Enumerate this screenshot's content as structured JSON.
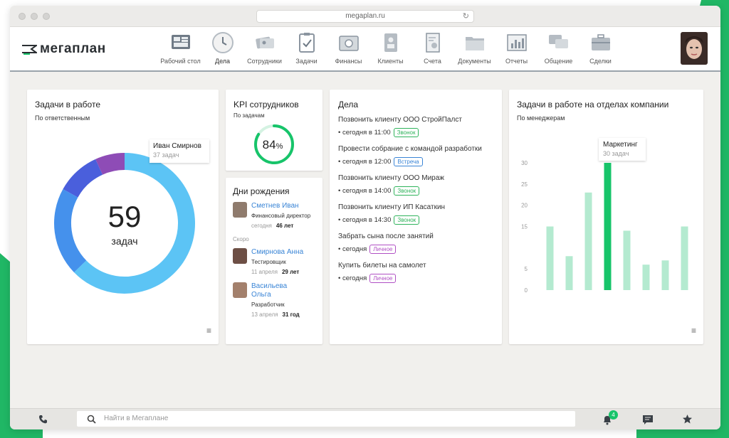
{
  "browser": {
    "url": "megaplan.ru"
  },
  "logo": {
    "text": "мегаплан"
  },
  "nav": [
    {
      "label": "Рабочий стол",
      "icon": "desktop-icon"
    },
    {
      "label": "Дела",
      "icon": "clock-icon"
    },
    {
      "label": "Сотрудники",
      "icon": "employees-icon"
    },
    {
      "label": "Задачи",
      "icon": "tasks-icon"
    },
    {
      "label": "Финансы",
      "icon": "safe-icon"
    },
    {
      "label": "Клиенты",
      "icon": "clients-icon"
    },
    {
      "label": "Счета",
      "icon": "invoice-icon"
    },
    {
      "label": "Документы",
      "icon": "folder-icon"
    },
    {
      "label": "Отчеты",
      "icon": "chart-icon"
    },
    {
      "label": "Общение",
      "icon": "chat-icon"
    },
    {
      "label": "Сделки",
      "icon": "briefcase-icon"
    }
  ],
  "tasks_card": {
    "title": "Задачи в работе",
    "subtitle": "По ответственным",
    "total": "59",
    "total_label": "задач",
    "tooltip_name": "Иван Смирнов",
    "tooltip_value": "37 задач",
    "segments": [
      {
        "value": 37,
        "color": "#5cc4f5"
      },
      {
        "value": 12,
        "color": "#4591ec"
      },
      {
        "value": 6,
        "color": "#4a5fdc"
      },
      {
        "value": 4,
        "color": "#8e4cb6"
      }
    ]
  },
  "kpi_card": {
    "title": "KPI сотрудников",
    "subtitle": "По задачам",
    "value": "84",
    "unit": "%",
    "fraction": 0.84
  },
  "birthdays_card": {
    "title": "Дни рождения",
    "soon_label": "Скоро",
    "today": {
      "name": "Сметнев Иван",
      "role": "Финансовый директор",
      "date": "сегодня",
      "age": "46 лет"
    },
    "upcoming": [
      {
        "name": "Смирнова Анна",
        "role": "Тестировщик",
        "date": "11 апреля",
        "age": "29 лет"
      },
      {
        "name": "Васильева Ольга",
        "role": "Разработчик",
        "date": "13 апреля",
        "age": "31 год"
      }
    ]
  },
  "deals_card": {
    "title": "Дела",
    "items": [
      {
        "title": "Позвонить клиенту ООО СтройПалст",
        "when": "сегодня в 11:00",
        "tag": "Звонок",
        "tag_color": "#2fb35b"
      },
      {
        "title": "Провести собрание с командой разработки",
        "when": "сегодня в 12:00",
        "tag": "Встреча",
        "tag_color": "#3a85d6"
      },
      {
        "title": "Позвонить клиенту ООО Мираж",
        "when": "сегодня в 14:00",
        "tag": "Звонок",
        "tag_color": "#2fb35b"
      },
      {
        "title": "Позвонить клиенту ИП Касаткин",
        "when": "сегодня в 14:30",
        "tag": "Звонок",
        "tag_color": "#2fb35b"
      },
      {
        "title": "Забрать сына после занятий",
        "when": "сегодня",
        "tag": "Личное",
        "tag_color": "#b04fc4"
      },
      {
        "title": "Купить билеты на самолет",
        "when": "сегодня",
        "tag": "Личное",
        "tag_color": "#b04fc4"
      }
    ]
  },
  "dept_card": {
    "title": "Задачи в работе на отделах компании",
    "subtitle": "По менеджерам",
    "tooltip_name": "Маркетинг",
    "tooltip_value": "30 задач"
  },
  "chart_data": {
    "type": "bar",
    "values": [
      15,
      8,
      23,
      30,
      14,
      6,
      7,
      15
    ],
    "yticks": [
      0,
      5,
      15,
      20,
      25,
      30
    ],
    "ylim": [
      0,
      30
    ],
    "highlight_index": 3,
    "color": "#b4ead0",
    "highlight_color": "#17c46a"
  },
  "footer": {
    "search_placeholder": "Найти в Мегаплане",
    "notifications_count": "4"
  }
}
